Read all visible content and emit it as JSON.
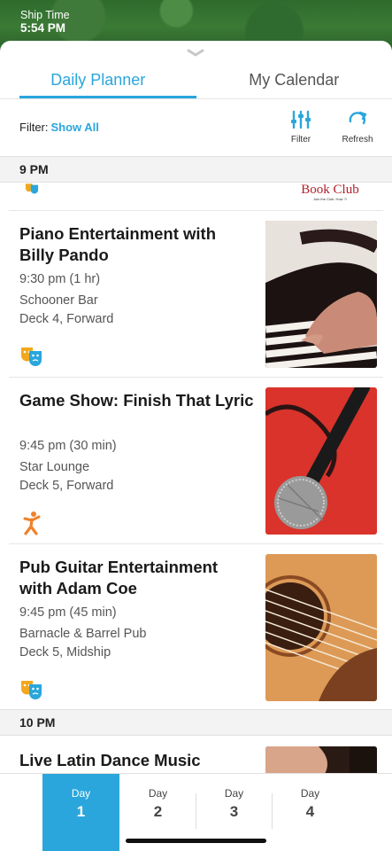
{
  "status": {
    "ship_time_label": "Ship Time",
    "ship_time": "5:54 PM"
  },
  "tabs": [
    {
      "label": "Daily Planner",
      "active": true
    },
    {
      "label": "My Calendar",
      "active": false
    }
  ],
  "filter": {
    "label": "Filter:",
    "value": "Show All"
  },
  "tools": {
    "filter_label": "Filter",
    "refresh_label": "Refresh"
  },
  "sections": {
    "nine": "9 PM",
    "ten": "10 PM"
  },
  "partial_top": {
    "thumb_title": "Book Club",
    "thumb_sub": "Join the Club. How ?!"
  },
  "events": [
    {
      "title": "Piano Entertainment with Billy Pando",
      "time": "9:30 pm (1 hr)",
      "venue": "Schooner Bar",
      "location": "Deck 4, Forward",
      "category_icon": "theater-masks-icon"
    },
    {
      "title": "Game Show: Finish That Lyric",
      "time": "9:45 pm (30 min)",
      "venue": "Star Lounge",
      "location": "Deck 5, Forward",
      "category_icon": "activity-person-icon"
    },
    {
      "title": "Pub Guitar Entertainment with Adam Coe",
      "time": "9:45 pm (45 min)",
      "venue": "Barnacle & Barrel Pub",
      "location": "Deck 5, Midship",
      "category_icon": "theater-masks-icon"
    },
    {
      "title": "Live Latin Dance Music"
    }
  ],
  "days": [
    {
      "label": "Day",
      "number": "1",
      "active": true
    },
    {
      "label": "Day",
      "number": "2",
      "active": false
    },
    {
      "label": "Day",
      "number": "3",
      "active": false
    },
    {
      "label": "Day",
      "number": "4",
      "active": false
    }
  ],
  "colors": {
    "accent": "#2aa6dc",
    "theater_yellow": "#f2a81d",
    "activity_orange": "#f0812a"
  }
}
